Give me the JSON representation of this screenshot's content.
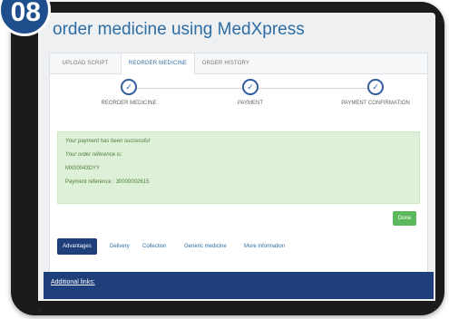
{
  "badge": "08",
  "page": {
    "title": "order medicine using MedXpress"
  },
  "tabs": [
    {
      "label": "UPLOAD SCRIPT"
    },
    {
      "label": "REORDER MEDICINE"
    },
    {
      "label": "ORDER HISTORY"
    }
  ],
  "steps": [
    {
      "label": "REORDER MEDICINE",
      "icon": "check-icon"
    },
    {
      "label": "PAYMENT",
      "icon": "check-icon"
    },
    {
      "label": "PAYMENT CONFIRMATION",
      "icon": "check-icon"
    }
  ],
  "success": {
    "line1": "Your payment has been successful",
    "line2": "Your order reference is:",
    "order_ref": "MX00043DYY",
    "payment_ref": "Payment reference : 30000002615"
  },
  "done_label": "Done",
  "bottom_tabs": [
    {
      "label": "Advantages"
    },
    {
      "label": "Delivery"
    },
    {
      "label": "Collection"
    },
    {
      "label": "Generic medicine"
    },
    {
      "label": "More information"
    }
  ],
  "additional_links": "Additional links:",
  "colors": {
    "accent": "#2e6da4",
    "success_bg": "#dff0d8",
    "done_button": "#5cb85c",
    "nav_dark": "#1f3f7a"
  }
}
